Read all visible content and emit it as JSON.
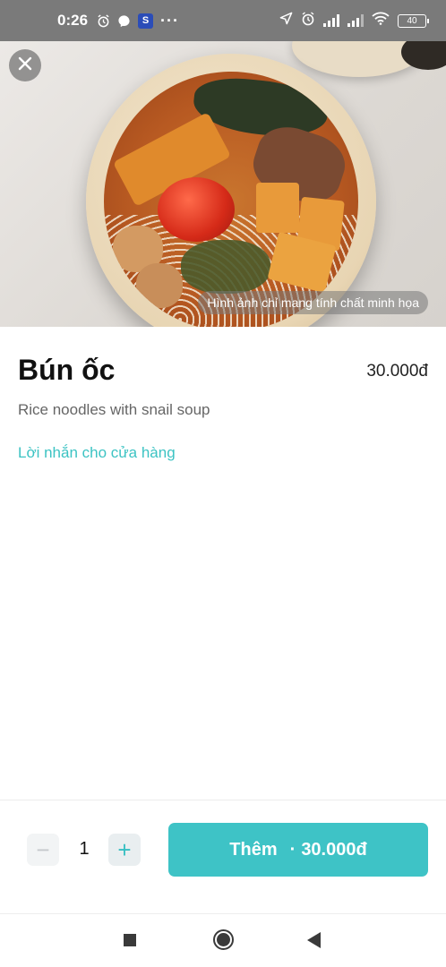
{
  "status_bar": {
    "time": "0:26",
    "battery": "40",
    "icons": [
      "alarm-icon",
      "messenger-icon",
      "app-icon",
      "more-dots-icon",
      "location-arrow-icon",
      "alarm-icon",
      "signal-icon",
      "signal-icon",
      "wifi-icon",
      "battery-icon"
    ],
    "app_letter": "S",
    "more": "···"
  },
  "hero": {
    "caption": "Hình ảnh chỉ mang tính chất minh họa",
    "close_icon": "close-icon"
  },
  "product": {
    "name": "Bún ốc",
    "price": "30.000đ",
    "description": "Rice noodles with snail soup",
    "note_link": "Lời nhắn cho cửa hàng"
  },
  "order": {
    "minus": "−",
    "plus": "+",
    "quantity": "1",
    "add_label": "Thêm",
    "separator": "·",
    "add_price": "30.000đ"
  },
  "nav": {
    "icons": [
      "recents-square-icon",
      "home-circle-icon",
      "back-triangle-icon"
    ]
  },
  "colors": {
    "accent": "#3ec3c6",
    "link": "#3cc3c3",
    "status_bar": "#7a7a7a"
  }
}
